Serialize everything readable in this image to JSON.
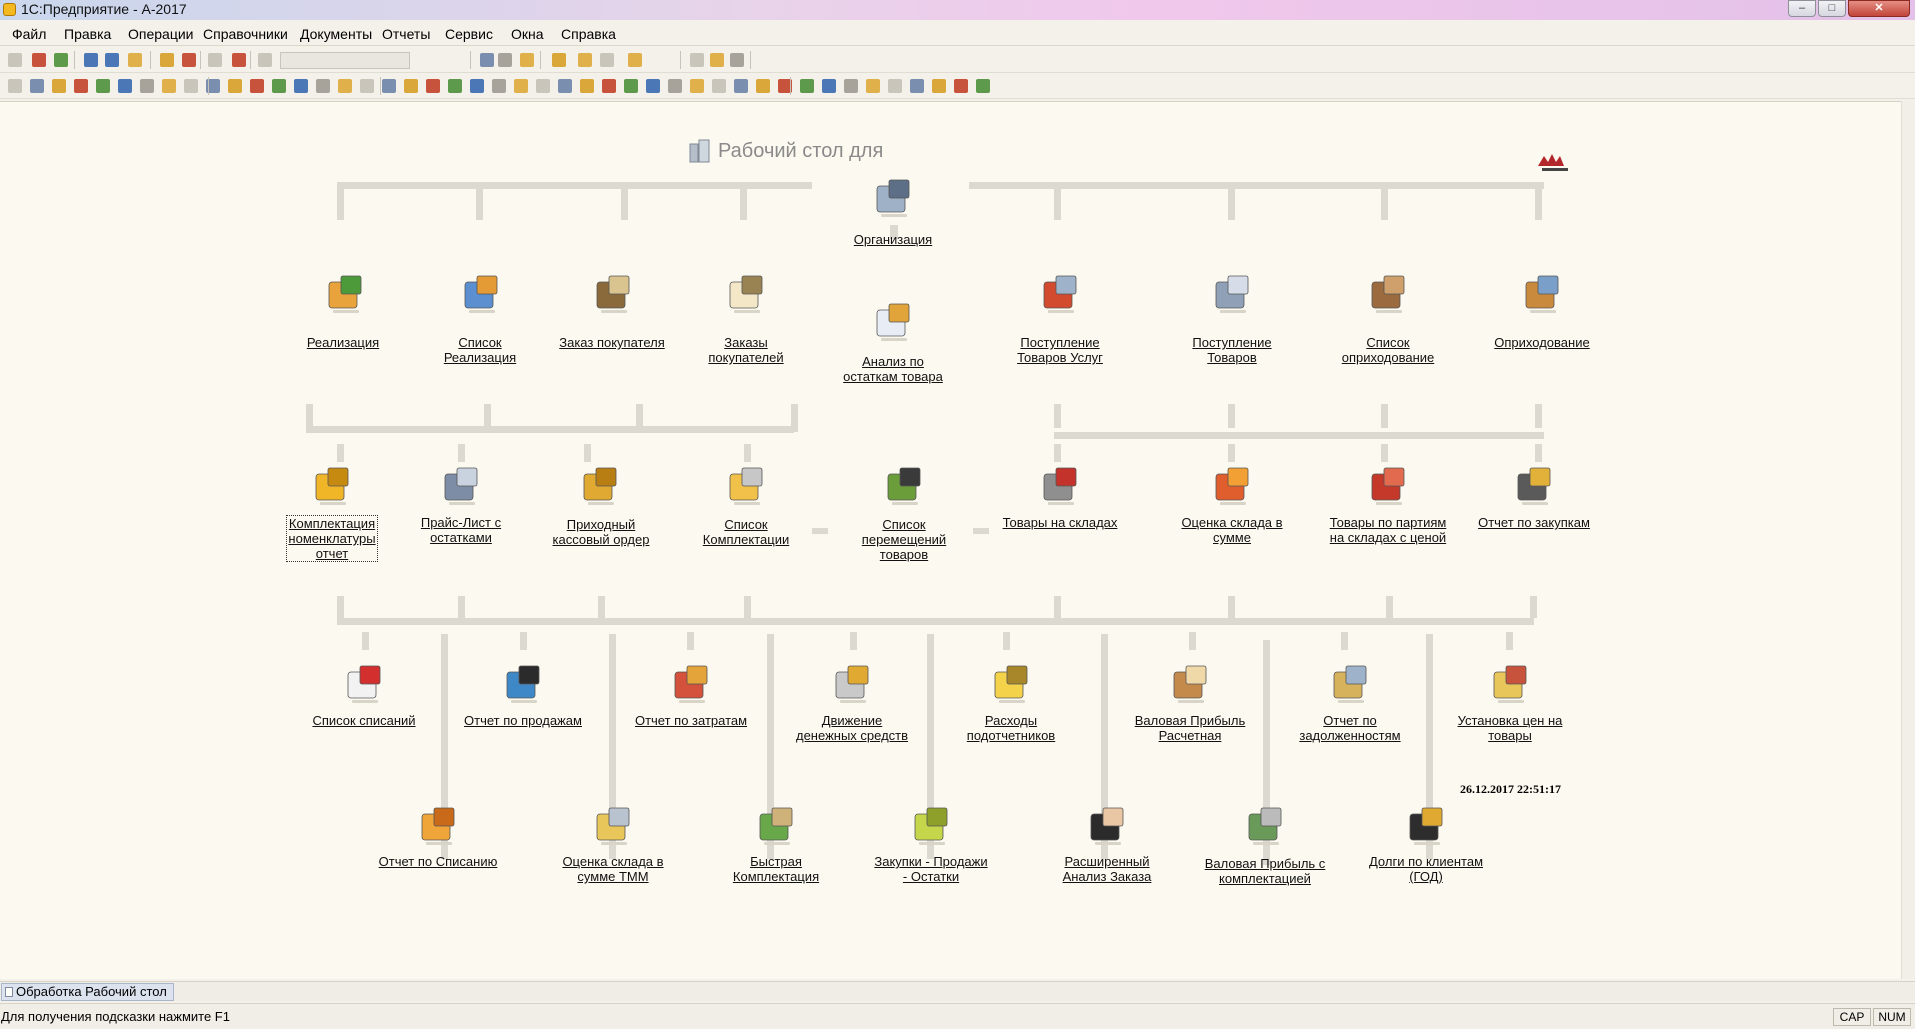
{
  "window": {
    "title": "1С:Предприятие - А-2017",
    "blurred_subtitle": "",
    "minimize": "–",
    "maximize": "□",
    "close": "✕"
  },
  "menu": [
    "Файл",
    "Правка",
    "Операции",
    "Справочники",
    "Документы",
    "Отчеты",
    "Сервис",
    "Окна",
    "Справка"
  ],
  "workspace": {
    "heading": "Рабочий стол для",
    "datetime": "26.12.2017 22:51:17",
    "organization": {
      "label": "Организация",
      "icon": "organization-icon"
    },
    "row1": [
      {
        "label": "Реализация",
        "icon": "sales-icon"
      },
      {
        "label": "Список\nРеализация",
        "icon": "basket-icon"
      },
      {
        "label": "Заказ покупателя",
        "icon": "customer-order-icon"
      },
      {
        "label": "Заказы\nпокупателей",
        "icon": "orders-list-icon"
      },
      {
        "label": "Анализ по\nостаткам товара",
        "icon": "stock-analysis-icon"
      },
      {
        "label": "Поступление\nТоваров Услуг",
        "icon": "receipt-services-icon"
      },
      {
        "label": "Поступление\nТоваров",
        "icon": "truck-icon"
      },
      {
        "label": "Список\nоприходование",
        "icon": "boxes-list-icon"
      },
      {
        "label": "Оприходование",
        "icon": "boxes-icon"
      }
    ],
    "row2": [
      {
        "label": "Комплектация\nноменклатуры\nотчет",
        "icon": "kit-report-icon"
      },
      {
        "label": "Прайс-Лист с\nостатками",
        "icon": "price-list-icon"
      },
      {
        "label": "Приходный\nкассовый ордер",
        "icon": "coins-icon"
      },
      {
        "label": "Список\nКомплектации",
        "icon": "kit-list-icon"
      },
      {
        "label": "Список\nперемещений\nтоваров",
        "icon": "forklift-icon"
      },
      {
        "label": "Товары на складах",
        "icon": "warehouse-icon"
      },
      {
        "label": "Оценка склада в\nсумме",
        "icon": "chart-icon"
      },
      {
        "label": "Товары по партиям\nна складах с ценой",
        "icon": "batches-icon"
      },
      {
        "label": "Отчет по закупкам",
        "icon": "purchase-truck-icon"
      }
    ],
    "row3": [
      {
        "label": "Список списаний",
        "icon": "writeoff-list-icon"
      },
      {
        "label": "Отчет по продажам",
        "icon": "cash-register-icon"
      },
      {
        "label": "Отчет по затратам",
        "icon": "expenses-icon"
      },
      {
        "label": "Движение\nденежных средств",
        "icon": "money-flow-icon"
      },
      {
        "label": "Расходы\nподотчетников",
        "icon": "accountable-icon"
      },
      {
        "label": "Валовая Прибыль\nРасчетная",
        "icon": "profit-icon"
      },
      {
        "label": "Отчет по\nзадолженностям",
        "icon": "debts-icon"
      },
      {
        "label": "Установка цен на\nтовары",
        "icon": "set-prices-icon"
      }
    ],
    "row4": [
      {
        "label": "Отчет по Списанию",
        "icon": "writeoff-report-icon"
      },
      {
        "label": "Оценка склада в\nсумме ТММ",
        "icon": "stock-tmm-icon"
      },
      {
        "label": "Быстрая\nКомплектация",
        "icon": "quick-kit-icon"
      },
      {
        "label": "Закупки - Продажи\n- Остатки",
        "icon": "folder-icon"
      },
      {
        "label": "Расширенный\nАнализ Заказа",
        "icon": "person-icon"
      },
      {
        "label": "Валовая Прибыль с\nкомплектацией",
        "icon": "money-stack-icon"
      },
      {
        "label": "Долги по клиентам\n(ГОД)",
        "icon": "client-debts-icon"
      }
    ]
  },
  "taskbar": {
    "window_button": "Обработка  Рабочий стол"
  },
  "status": {
    "hint": "Для получения подсказки нажмите F1",
    "cap": "CAP",
    "num": "NUM"
  },
  "colors": {
    "workspace_bg": "#fcfaf0",
    "chrome_bg": "#f3f1ea",
    "connector": "#dcd9d0"
  }
}
